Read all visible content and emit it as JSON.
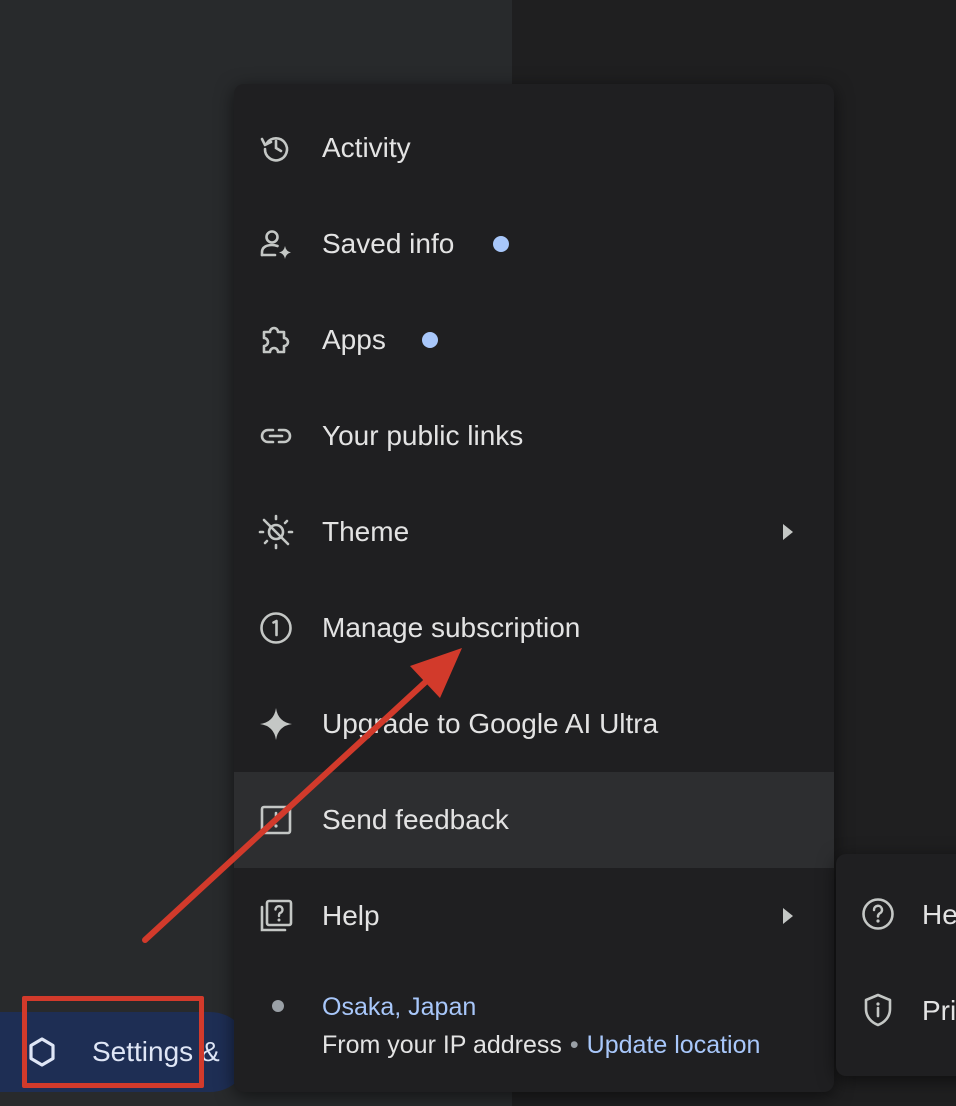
{
  "sidebar": {
    "settings_label": "Settings &"
  },
  "menu": {
    "items": [
      {
        "label": "Activity",
        "icon": "history-icon"
      },
      {
        "label": "Saved info",
        "icon": "person-sparkle-icon",
        "dot": true
      },
      {
        "label": "Apps",
        "icon": "puzzle-icon",
        "dot": true
      },
      {
        "label": "Your public links",
        "icon": "link-icon"
      },
      {
        "label": "Theme",
        "icon": "theme-icon",
        "submenu": true
      },
      {
        "label": "Manage subscription",
        "icon": "subscription-icon"
      },
      {
        "label": "Upgrade to Google AI Ultra",
        "icon": "sparkle-icon"
      },
      {
        "label": "Send feedback",
        "icon": "feedback-icon",
        "highlighted": true
      },
      {
        "label": "Help",
        "icon": "help-icon",
        "submenu": true
      }
    ],
    "location": {
      "city": "Osaka, Japan",
      "source": "From your IP address",
      "separator": "•",
      "update_link": "Update location"
    }
  },
  "help_submenu": {
    "items": [
      {
        "label": "He",
        "icon": "question-circle-icon"
      },
      {
        "label": "Pri",
        "icon": "privacy-shield-icon"
      }
    ]
  },
  "colors": {
    "accent": "#a8c7fa",
    "annotation": "#d23a2b",
    "menu_bg": "#1f1f21",
    "highlight_bg": "#2d2e30"
  }
}
